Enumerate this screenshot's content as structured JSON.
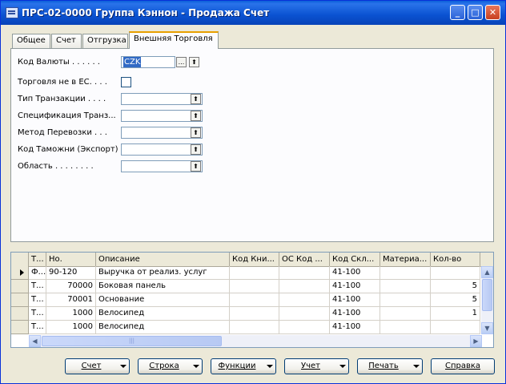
{
  "window": {
    "title": "ПРС-02-0000 Группа Кэннон - Продажа Счет",
    "minimize_glyph": "_",
    "maximize_glyph": "□",
    "close_glyph": "✕"
  },
  "tabs": [
    {
      "label": "Общее"
    },
    {
      "label": "Счет"
    },
    {
      "label": "Отгрузка"
    },
    {
      "label": "Внешняя Торговля"
    }
  ],
  "active_tab": "Внешняя Торговля",
  "form": {
    "currency_code": {
      "label": "Код Валюты . . . . . .",
      "value": "CZK",
      "lookup_glyph": "...",
      "up_glyph": "⬆"
    },
    "non_eu_trade": {
      "label": "Торговля не в ЕС. . . .",
      "checked": false
    },
    "transaction_type": {
      "label": "Тип Транзакции . . . .",
      "value": "",
      "up_glyph": "⬆"
    },
    "transaction_spec": {
      "label": "Спецификация Транз...",
      "value": "",
      "up_glyph": "⬆"
    },
    "transport_method": {
      "label": "Метод Перевозки . . .",
      "value": "",
      "up_glyph": "⬆"
    },
    "exit_point": {
      "label": "Код Таможни (Экспорт)",
      "value": "",
      "up_glyph": "⬆"
    },
    "area": {
      "label": "Область . . . . . . . .",
      "value": "",
      "up_glyph": "⬆"
    }
  },
  "lines": {
    "columns": [
      "Т...",
      "Но.",
      "Описание",
      "Код Кни...",
      "ОС Код ...",
      "Код Скл...",
      "Материа...",
      "Кол-во"
    ],
    "rows": [
      {
        "type": "Ф...",
        "no": "90-120",
        "description": "Выручка от реализ. услуг",
        "book_code": "",
        "fa_code": "",
        "location": "41-100",
        "material": "",
        "qty": "",
        "current": true
      },
      {
        "type": "Т...",
        "no": "70000",
        "description": "Боковая панель",
        "book_code": "",
        "fa_code": "",
        "location": "41-100",
        "material": "",
        "qty": "5",
        "current": false
      },
      {
        "type": "Т...",
        "no": "70001",
        "description": "Основание",
        "book_code": "",
        "fa_code": "",
        "location": "41-100",
        "material": "",
        "qty": "5",
        "current": false
      },
      {
        "type": "Т...",
        "no": "1000",
        "description": "Велосипед",
        "book_code": "",
        "fa_code": "",
        "location": "41-100",
        "material": "",
        "qty": "1",
        "current": false
      },
      {
        "type": "Т...",
        "no": "1000",
        "description": "Велосипед",
        "book_code": "",
        "fa_code": "",
        "location": "41-100",
        "material": "",
        "qty": "",
        "current": false
      }
    ]
  },
  "scroll_glyphs": {
    "up": "▲",
    "down": "▼",
    "left": "◀",
    "right": "▶",
    "grip": "|||"
  },
  "buttons": {
    "invoice": "Счет",
    "line": "Строка",
    "functions": "Функции",
    "post": "Учет",
    "print": "Печать",
    "help": "Справка"
  },
  "colors": {
    "titlebar": "#0a52d1",
    "selection": "#316ac5",
    "active_tab_accent": "#e8a000"
  }
}
